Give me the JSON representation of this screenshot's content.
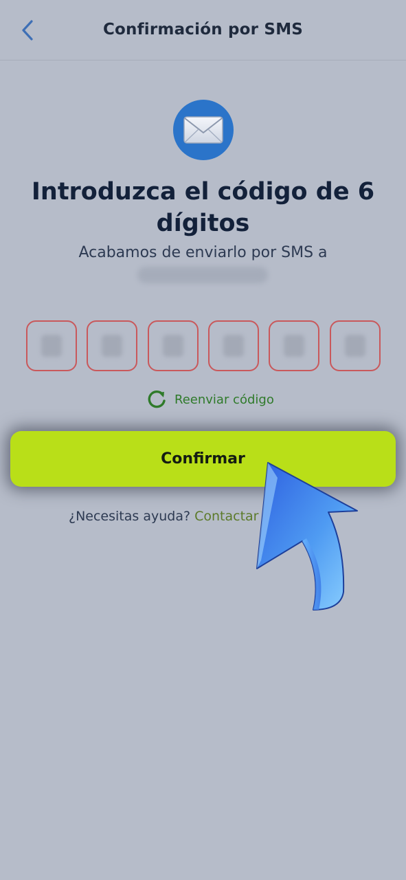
{
  "header": {
    "title": "Confirmación por SMS",
    "back_icon": "chevron-left-icon"
  },
  "hero": {
    "icon": "envelope-icon",
    "heading": "Introduzca el código de 6 dígitos",
    "subtitle": "Acabamos de enviarlo por SMS a"
  },
  "code_inputs": {
    "count": 6
  },
  "resend": {
    "icon": "refresh-icon",
    "label": "Reenviar código"
  },
  "confirm": {
    "label": "Confirmar"
  },
  "help": {
    "prefix": "¿Necesitas ayuda?",
    "link": "Contactar"
  },
  "overlay": {
    "icon": "pointer-arrow-icon"
  },
  "colors": {
    "background": "#b6bcc9",
    "accent_button": "#b9df18",
    "mail_badge": "#2b74c9",
    "code_border": "#c9585b",
    "resend_green": "#2f7a2a",
    "link_green": "#5c7a2a"
  }
}
